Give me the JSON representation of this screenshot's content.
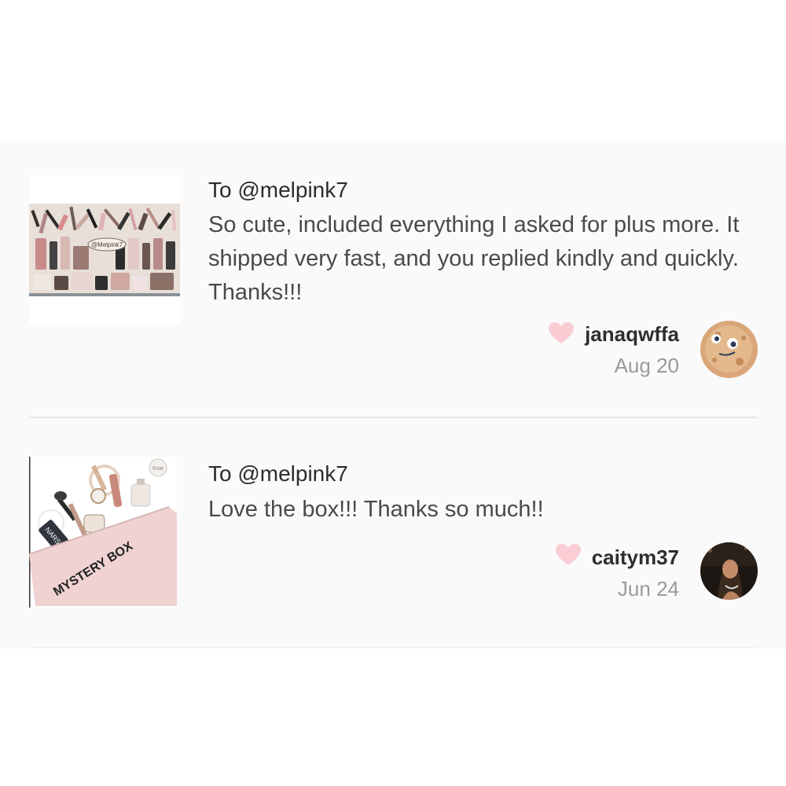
{
  "reviews": [
    {
      "to": "To @melpink7",
      "text": "So cute, included everything I asked for plus more. It shipped very fast, and you replied kindly and quickly. Thanks!!!",
      "username": "janaqwffa",
      "date": "Aug 20",
      "photo_watermark": "@Melpink7",
      "heart_icon": "heart-icon",
      "heart_color": "#f9cdd3"
    },
    {
      "to": "To @melpink7",
      "text": "Love the box!!! Thanks so much!!",
      "username": "caitym37",
      "date": "Jun 24",
      "photo_text": "MYSTERY BOX",
      "photo_brand": "NARS",
      "photo_jar": "RAW",
      "heart_icon": "heart-icon",
      "heart_color": "#f9cdd3"
    }
  ],
  "colors": {
    "background": "#fafafa",
    "divider": "#ebe3e5",
    "heart": "#f9cdd3",
    "username": "#2e2e2e",
    "date": "#9a9a9a"
  }
}
